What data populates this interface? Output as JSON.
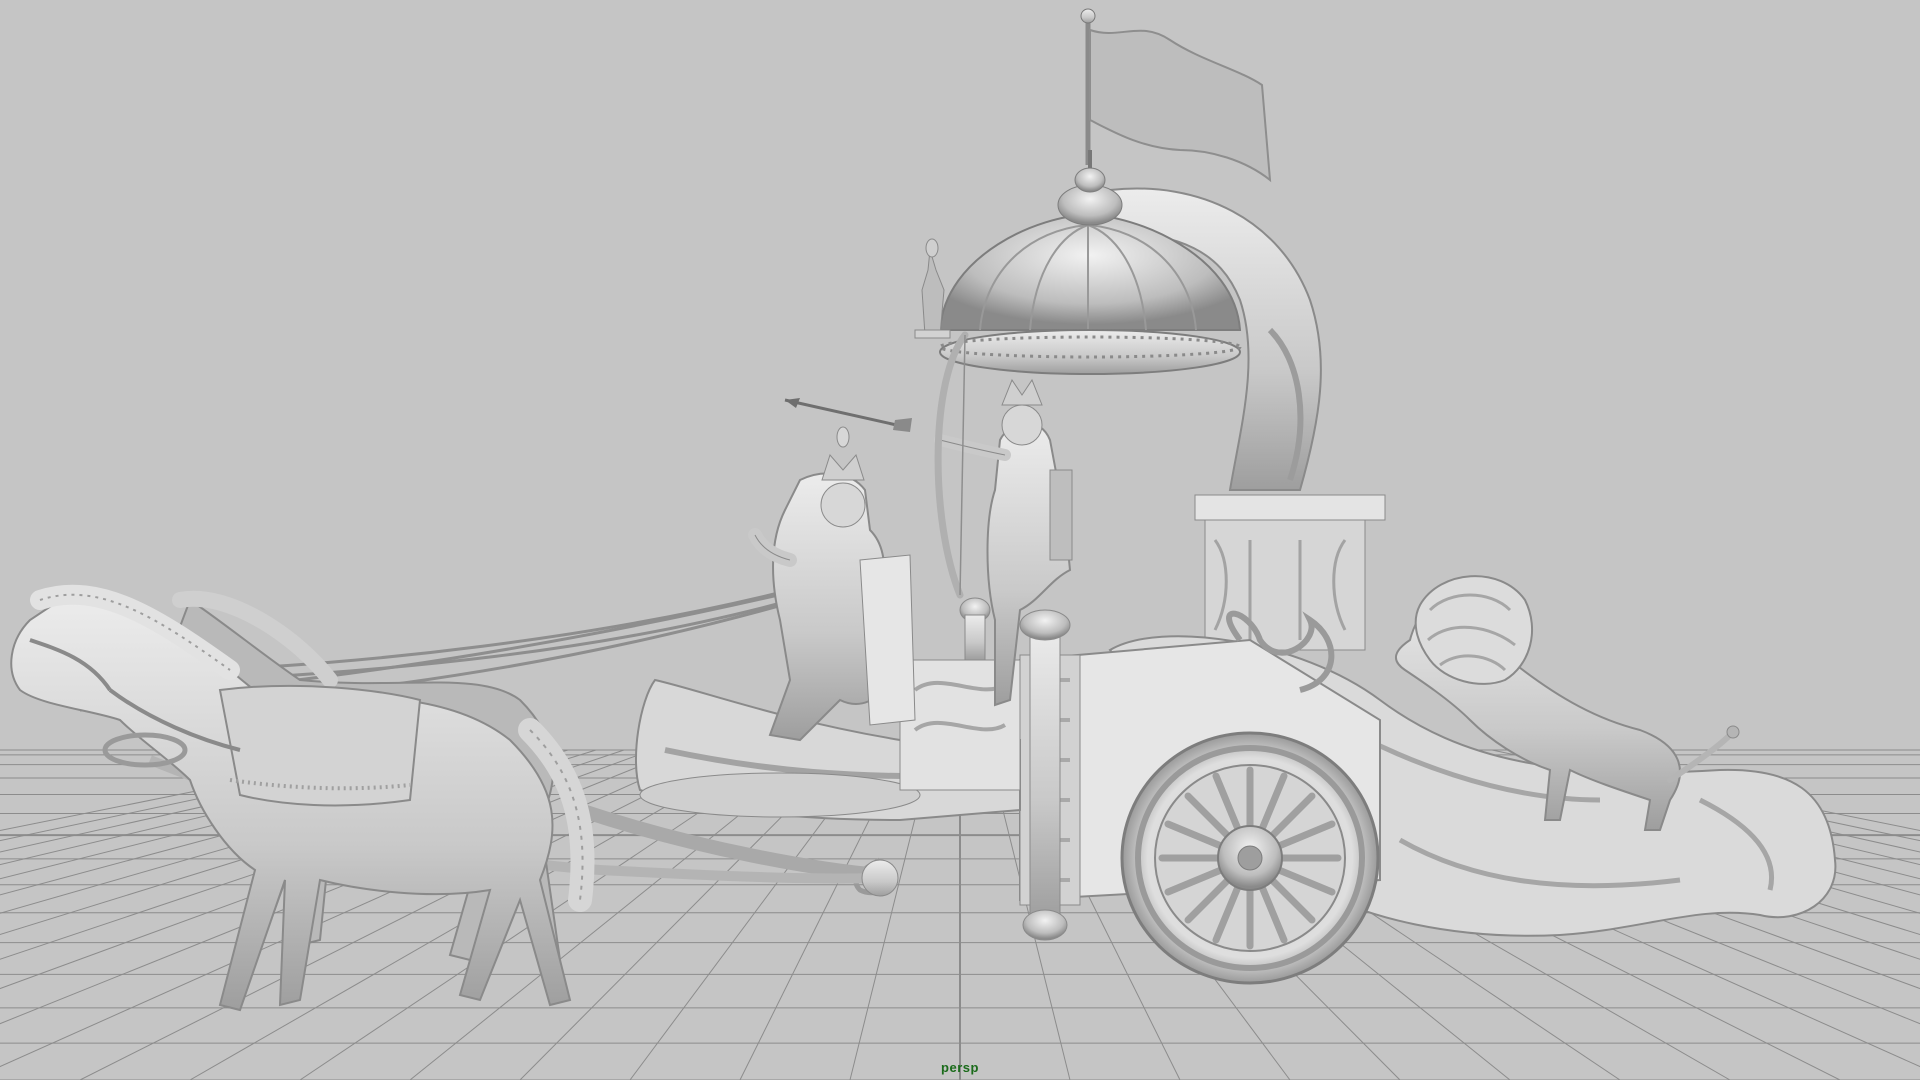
{
  "viewport": {
    "camera_name": "persp",
    "background_color": "#c5c5c5",
    "grid_color": "#8c8c8c",
    "model_color": "#d4d4d4",
    "model_shadow": "#9a9a9a"
  },
  "scene": {
    "objects": [
      "horse-icon",
      "chariot-icon",
      "wheel-icon",
      "canopy-icon",
      "flag-icon",
      "lion-icon",
      "charioteer-figure-icon",
      "archer-figure-icon",
      "bow-icon",
      "arrow-icon"
    ]
  }
}
